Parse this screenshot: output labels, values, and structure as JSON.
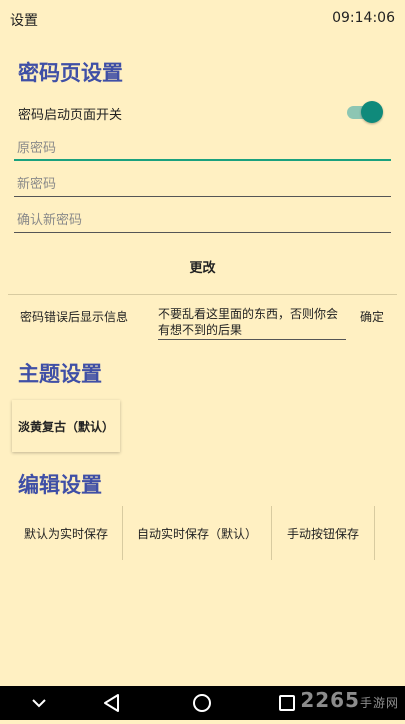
{
  "status_bar": {
    "title": "设置",
    "time": "09:14:06"
  },
  "password_section": {
    "title": "密码页设置",
    "toggle_label": "密码启动页面开关",
    "toggle_on": true,
    "old_password_placeholder": "原密码",
    "new_password_placeholder": "新密码",
    "confirm_password_placeholder": "确认新密码",
    "change_label": "更改",
    "error_msg_label": "密码错误后显示信息",
    "error_msg_value": "不要乱看这里面的东西，否则你会有想不到的后果",
    "confirm_label": "确定"
  },
  "theme_section": {
    "title": "主题设置",
    "options": [
      "淡黄复古（默认）"
    ]
  },
  "edit_section": {
    "title": "编辑设置",
    "options": [
      "默认为实时保存",
      "自动实时保存（默认）",
      "手动按钮保存"
    ]
  },
  "watermark": {
    "main": "2265",
    "sub": "手游网"
  },
  "colors": {
    "background": "#FFF0C2",
    "heading": "#3F4FA6",
    "accent": "#0F8A7B",
    "focus_underline": "#1AA17E",
    "navbar": "#000000"
  }
}
